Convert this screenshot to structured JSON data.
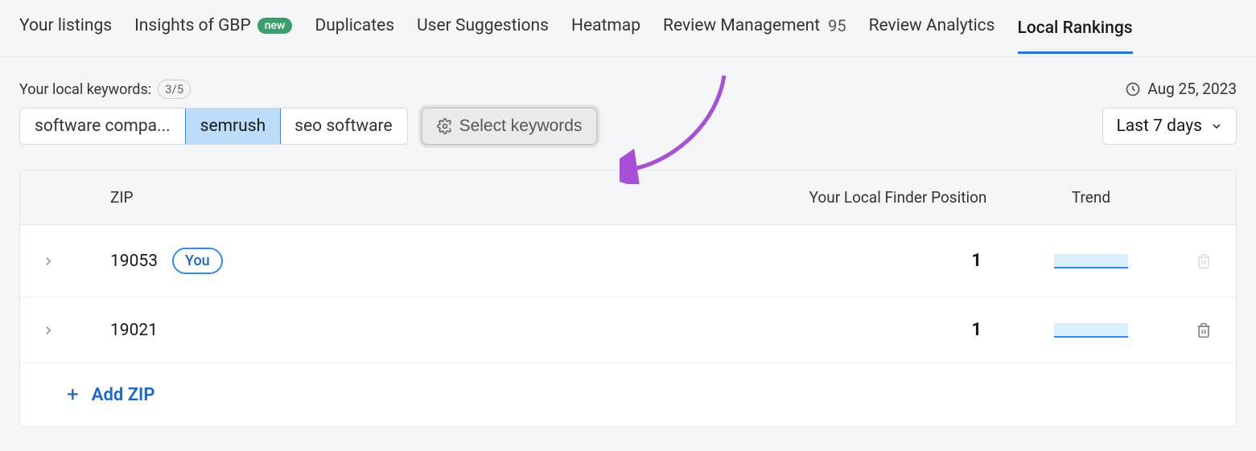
{
  "tabs": [
    {
      "label": "Your listings"
    },
    {
      "label": "Insights of GBP",
      "badge": "new"
    },
    {
      "label": "Duplicates"
    },
    {
      "label": "User Suggestions"
    },
    {
      "label": "Heatmap"
    },
    {
      "label": "Review Management",
      "count": "95"
    },
    {
      "label": "Review Analytics"
    },
    {
      "label": "Local Rankings",
      "active": true
    }
  ],
  "kw": {
    "label": "Your local keywords:",
    "count": "3/5",
    "chips": [
      {
        "label": "software compa...",
        "selected": false
      },
      {
        "label": "semrush",
        "selected": true
      },
      {
        "label": "seo software",
        "selected": false
      }
    ],
    "select_btn": "Select keywords"
  },
  "date": {
    "stamp": "Aug 25, 2023",
    "range": "Last 7 days"
  },
  "table": {
    "headers": {
      "zip": "ZIP",
      "pos": "Your Local Finder Position",
      "trend": "Trend"
    },
    "rows": [
      {
        "zip": "19053",
        "you": "You",
        "pos": "1",
        "deletable": false
      },
      {
        "zip": "19021",
        "you": null,
        "pos": "1",
        "deletable": true
      }
    ],
    "add_label": "Add ZIP"
  }
}
